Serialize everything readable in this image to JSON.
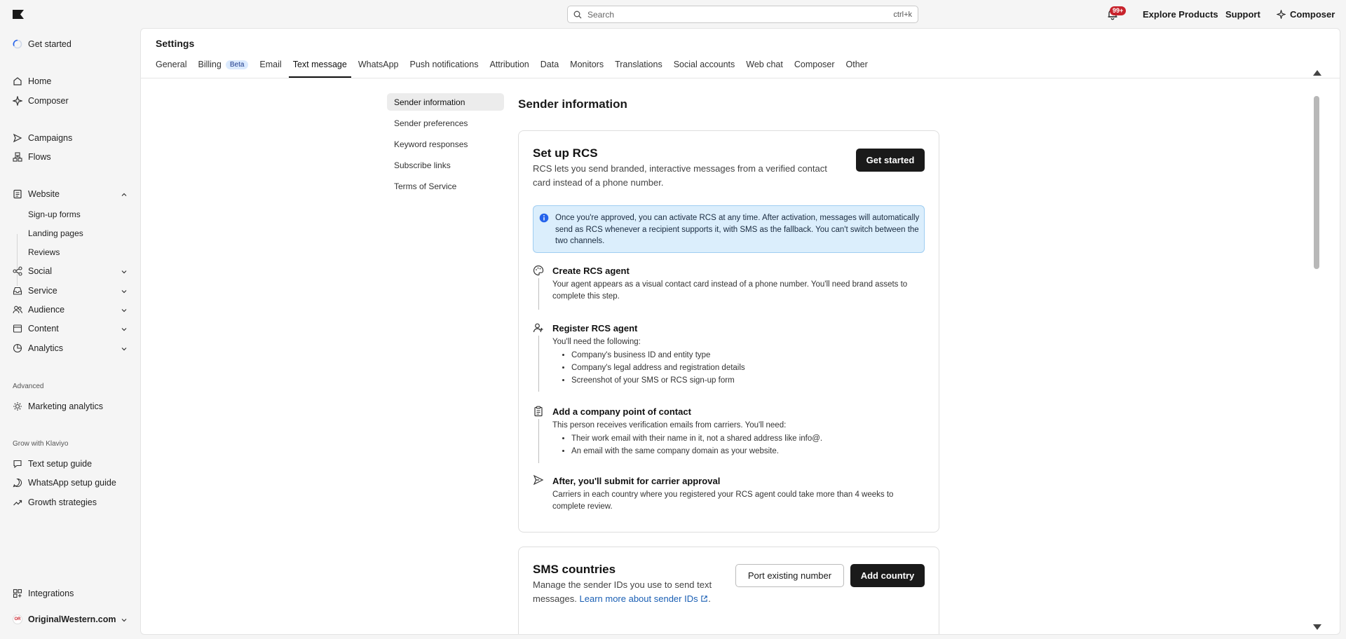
{
  "topbar": {
    "search_placeholder": "Search",
    "search_shortcut": "ctrl+k",
    "notifications_badge": "99+",
    "explore": "Explore Products",
    "support": "Support",
    "composer": "Composer"
  },
  "sidebar": {
    "get_started": "Get started",
    "home": "Home",
    "composer": "Composer",
    "campaigns": "Campaigns",
    "flows": "Flows",
    "website": "Website",
    "website_sub": [
      "Sign-up forms",
      "Landing pages",
      "Reviews"
    ],
    "social": "Social",
    "service": "Service",
    "audience": "Audience",
    "content": "Content",
    "analytics": "Analytics",
    "advanced_heading": "Advanced",
    "marketing_analytics": "Marketing analytics",
    "grow_heading": "Grow with Klaviyo",
    "text_setup": "Text setup guide",
    "whatsapp_setup": "WhatsApp setup guide",
    "growth": "Growth strategies",
    "integrations": "Integrations",
    "org": "OriginalWestern.com",
    "org_initials": "OR"
  },
  "settings": {
    "title": "Settings",
    "tabs": [
      "General",
      "Billing",
      "Email",
      "Text message",
      "WhatsApp",
      "Push notifications",
      "Attribution",
      "Data",
      "Monitors",
      "Translations",
      "Social accounts",
      "Web chat",
      "Composer",
      "Other"
    ],
    "billing_badge": "Beta",
    "subnav": [
      "Sender information",
      "Sender preferences",
      "Keyword responses",
      "Subscribe links",
      "Terms of Service"
    ]
  },
  "sender": {
    "section_title": "Sender information",
    "rcs": {
      "title": "Set up RCS",
      "desc": "RCS lets you send branded, interactive messages from a verified contact card instead of a phone number.",
      "button": "Get started",
      "info": "Once you're approved, you can activate RCS at any time. After activation, messages will automatically send as RCS whenever a recipient supports it, with SMS as the fallback. You can't switch between the two channels.",
      "steps": [
        {
          "title": "Create RCS agent",
          "text": "Your agent appears as a visual contact card instead of a phone number. You'll need brand assets to complete this step.",
          "items": []
        },
        {
          "title": "Register RCS agent",
          "text": "You'll need the following:",
          "items": [
            "Company's business ID and entity type",
            "Company's legal address and registration details",
            "Screenshot of your SMS or RCS sign-up form"
          ]
        },
        {
          "title": "Add a company point of contact",
          "text": "This person receives verification emails from carriers. You'll need:",
          "items": [
            "Their work email with their name in it, not a shared address like info@.",
            "An email with the same company domain as your website."
          ]
        },
        {
          "title": "After, you'll submit for carrier approval",
          "text": "Carriers in each country where you registered your RCS agent could take more than 4 weeks to complete review.",
          "items": []
        }
      ]
    },
    "sms": {
      "title": "SMS countries",
      "desc": "Manage the sender IDs you use to send text messages.",
      "link": "Learn more about sender IDs",
      "port_button": "Port existing number",
      "add_button": "Add country"
    }
  }
}
